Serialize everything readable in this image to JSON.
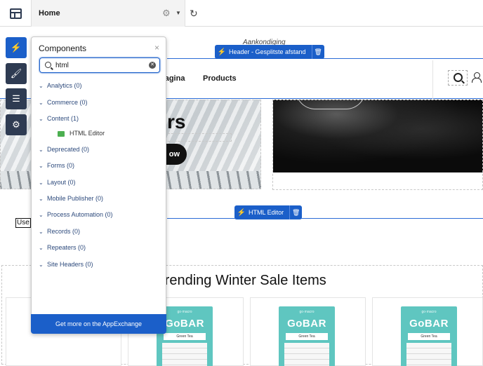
{
  "topbar": {
    "page_label": "Home",
    "icons": {
      "app": "app-layout-icon",
      "settings": "gear-icon",
      "dropdown": "caret-down-icon",
      "refresh": "refresh-icon"
    }
  },
  "canvas": {
    "announcement": "Aankondiging",
    "header_tag": {
      "label": "Header - Gesplitste afstand",
      "icon": "bolt-icon",
      "delete_icon": "trash-icon"
    },
    "nav_items": [
      "pagina",
      "Products"
    ],
    "hero": {
      "title_fragment": "rs",
      "button_fragment": "ow"
    },
    "html_editor_tag": {
      "label": "HTML Editor",
      "icon": "bolt-icon",
      "delete_icon": "trash-icon"
    },
    "use_text": "Use",
    "section_title": "Trending Winter Sale Items",
    "products": [
      {
        "brand_mini": "go·macro",
        "brand": "GoBAR",
        "flavor": "Green Tea"
      },
      {
        "brand_mini": "go·macro",
        "brand": "GoBAR",
        "flavor": "Green Tea"
      },
      {
        "brand_mini": "go·macro",
        "brand": "GoBAR",
        "flavor": "Green Tea"
      }
    ]
  },
  "rail": {
    "buttons": [
      {
        "name": "components",
        "icon": "bolt-icon",
        "glyph": "⚡",
        "active": true
      },
      {
        "name": "theme",
        "icon": "brush-icon",
        "glyph": "🖌"
      },
      {
        "name": "page-structure",
        "icon": "list-icon",
        "glyph": "☰"
      },
      {
        "name": "settings",
        "icon": "gear-icon",
        "glyph": "⚙"
      }
    ]
  },
  "panel": {
    "title": "Components",
    "close_glyph": "×",
    "search": {
      "value": "html",
      "placeholder": "Search"
    },
    "categories": [
      {
        "label": "Analytics (0)"
      },
      {
        "label": "Commerce (0)"
      },
      {
        "label": "Content (1)"
      },
      {
        "label": "Deprecated (0)"
      },
      {
        "label": "Forms (0)"
      },
      {
        "label": "Layout (0)"
      },
      {
        "label": "Mobile Publisher (0)"
      },
      {
        "label": "Process Automation (0)"
      },
      {
        "label": "Records (0)"
      },
      {
        "label": "Repeaters (0)"
      },
      {
        "label": "Site Headers (0)"
      }
    ],
    "content_child": {
      "label": "HTML Editor",
      "icon": "html-component-icon"
    },
    "footer": "Get more on the AppExchange"
  }
}
